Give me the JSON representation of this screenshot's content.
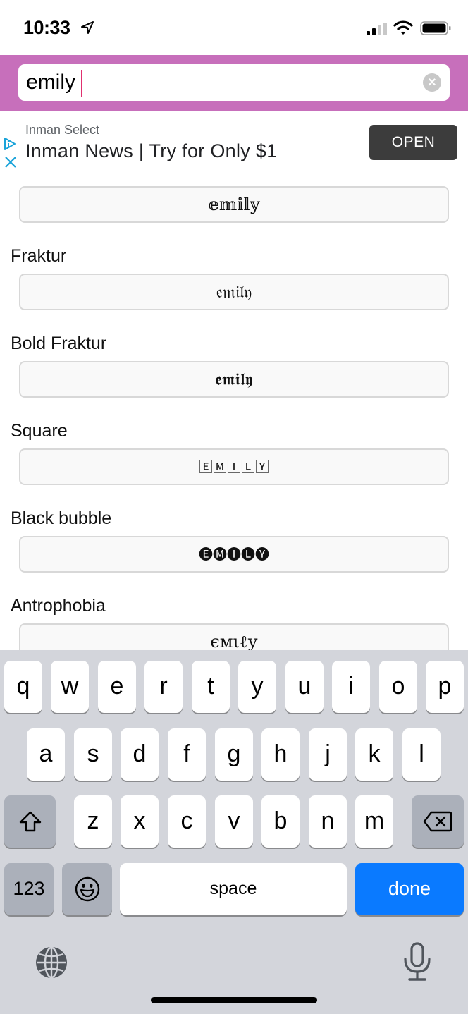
{
  "status_bar": {
    "time": "10:33",
    "location_icon": "location-arrow-icon",
    "signal_icon": "cellular-signal-icon",
    "wifi_icon": "wifi-icon",
    "battery_icon": "battery-icon"
  },
  "search": {
    "value": "emily",
    "clear_icon": "clear-circle-icon",
    "clear_glyph": "×",
    "accent_color": "#c76fbb"
  },
  "ad": {
    "sponsor": "Inman Select",
    "headline": "Inman News | Try for Only $1",
    "open_label": "OPEN",
    "choices_icon": "adchoices-icon",
    "close_icon": "close-icon"
  },
  "styles": [
    {
      "label": "",
      "preview": "𝕖𝕞𝕚𝕝𝕪"
    },
    {
      "label": "Fraktur",
      "preview": "𝔢𝔪𝔦𝔩𝔶"
    },
    {
      "label": "Bold Fraktur",
      "preview": "𝖊𝖒𝖎𝖑𝖞"
    },
    {
      "label": "Square",
      "preview": "🄴🄼🄸🄻🅈"
    },
    {
      "label": "Black bubble",
      "preview": "🅔🅜🅘🅛🅨"
    },
    {
      "label": "Antrophobia",
      "preview": "ϵмιℓу"
    }
  ],
  "keyboard": {
    "row1": [
      "q",
      "w",
      "e",
      "r",
      "t",
      "y",
      "u",
      "i",
      "o",
      "p"
    ],
    "row2": [
      "a",
      "s",
      "d",
      "f",
      "g",
      "h",
      "j",
      "k",
      "l"
    ],
    "row3": [
      "z",
      "x",
      "c",
      "v",
      "b",
      "n",
      "m"
    ],
    "shift_icon": "shift-icon",
    "delete_icon": "backspace-icon",
    "numbers_label": "123",
    "emoji_icon": "emoji-icon",
    "space_label": "space",
    "done_label": "done",
    "globe_icon": "globe-icon",
    "mic_icon": "microphone-icon",
    "done_color": "#0a7aff"
  }
}
